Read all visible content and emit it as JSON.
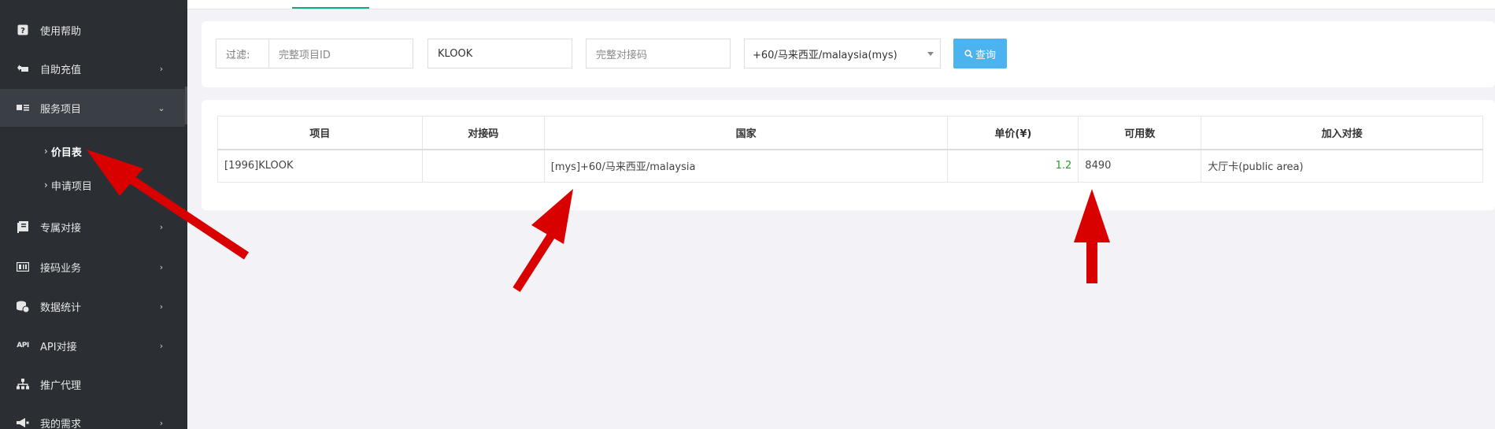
{
  "sidebar": {
    "items": [
      {
        "label": "使用帮助",
        "icon": "question-icon",
        "chevron": ""
      },
      {
        "label": "自助充值",
        "icon": "recharge-icon",
        "chevron": "›"
      },
      {
        "label": "服务项目",
        "icon": "card-list-icon",
        "chevron": "⌄"
      },
      {
        "label": "专属对接",
        "icon": "book-icon",
        "chevron": "›"
      },
      {
        "label": "接码业务",
        "icon": "sim-icon",
        "chevron": "›"
      },
      {
        "label": "数据统计",
        "icon": "coins-icon",
        "chevron": "›"
      },
      {
        "label": "API对接",
        "icon": "api-icon",
        "icon_text": "API",
        "chevron": "›"
      },
      {
        "label": "推广代理",
        "icon": "org-chart-icon",
        "chevron": ""
      },
      {
        "label": "我的需求",
        "icon": "megaphone-icon",
        "chevron": "›"
      }
    ],
    "subitems": [
      {
        "label": "价目表",
        "arrow": "›",
        "active": true
      },
      {
        "label": "申请项目",
        "arrow": "›",
        "active": false
      }
    ]
  },
  "filter": {
    "label": "过滤:",
    "project_id_placeholder": "完整项目ID",
    "project_name_value": "KLOOK",
    "code_placeholder": "完整对接码",
    "country_selected": "+60/马来西亚/malaysia(mys)",
    "query_label": "查询"
  },
  "table": {
    "headers": [
      "项目",
      "对接码",
      "国家",
      "单价(¥)",
      "可用数",
      "加入对接"
    ],
    "rows": [
      {
        "project": "[1996]KLOOK",
        "code": "",
        "country": "[mys]+60/马来西亚/malaysia",
        "price": "1.2",
        "available": "8490",
        "join": "大厅卡(public area)"
      }
    ]
  },
  "colors": {
    "sidebar_bg": "#2b2f33",
    "accent_teal": "#17a589",
    "query_button": "#4ab3f0",
    "price_green": "#2e9c2e",
    "annotation_red": "#d90000"
  }
}
